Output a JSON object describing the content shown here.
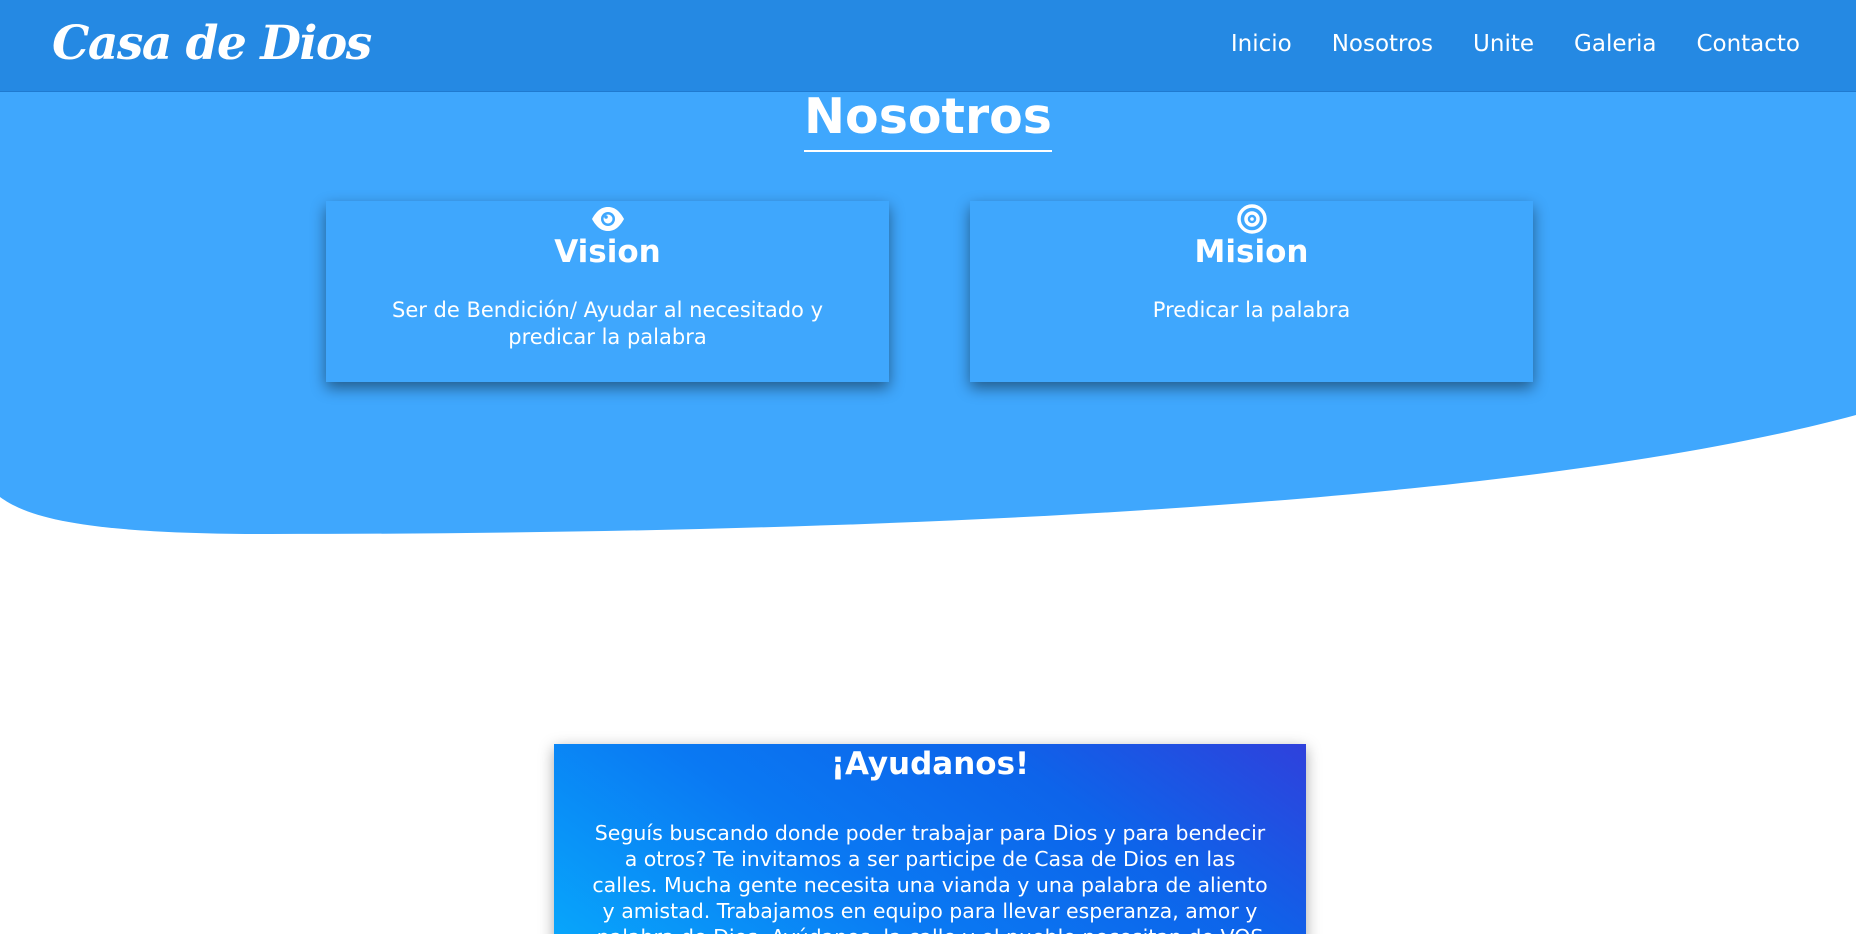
{
  "header": {
    "brand": "Casa de Dios",
    "nav": [
      "Inicio",
      "Nosotros",
      "Unite",
      "Galeria",
      "Contacto"
    ]
  },
  "about": {
    "title": "Nosotros",
    "cards": [
      {
        "icon": "eye-icon",
        "title": "Vision",
        "text": "Ser de Bendición/ Ayudar al necesitado y predicar la palabra"
      },
      {
        "icon": "target-icon",
        "title": "Mision",
        "text": "Predicar la palabra"
      }
    ]
  },
  "help": {
    "title": "¡Ayudanos!",
    "text": "Seguís buscando donde poder trabajar para Dios y para bendecir a otros? Te invitamos a ser participe de Casa de Dios en las calles. Mucha gente necesita una vianda y una palabra de aliento y amistad. Trabajamos en equipo para llevar esperanza, amor y palabra de Dios. Ayúdanos, la calle y el pueblo necesitan de VOS"
  },
  "colors": {
    "header": "#2589e3",
    "section": "#3fa7fd",
    "card": "#3fa7fd",
    "text": "#ffffff"
  }
}
